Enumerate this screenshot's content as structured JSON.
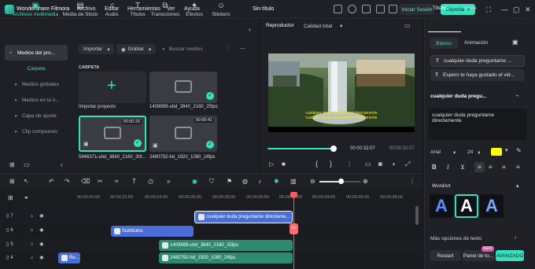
{
  "app": {
    "name": "Wondershare Filmora",
    "menu": [
      "Archivo",
      "Editar",
      "Herramientas",
      "Ver",
      "Ayuda"
    ],
    "project_title": "Sin título",
    "login_label": "Iniciar Sesión",
    "export_label": "Exportar",
    "accent": "#36e0bf"
  },
  "media_tabs": [
    {
      "label": "Archivos multimedia",
      "icon": "folder-icon"
    },
    {
      "label": "Media de Stock",
      "icon": "stock-icon"
    },
    {
      "label": "Audio",
      "icon": "music-icon"
    },
    {
      "label": "Títulos",
      "icon": "text-icon"
    },
    {
      "label": "Transiciones",
      "icon": "transition-icon"
    },
    {
      "label": "Efectos",
      "icon": "effects-icon"
    },
    {
      "label": "Stickers",
      "icon": "sticker-icon"
    }
  ],
  "sidebar": [
    {
      "label": "Medios del pro..."
    },
    {
      "label": "Carpeta"
    },
    {
      "label": "Medios globales"
    },
    {
      "label": "Medios en la n..."
    },
    {
      "label": "Capa de ajuste"
    },
    {
      "label": "Clip compuesto"
    }
  ],
  "media_toolbar": {
    "import_label": "Importar",
    "record_label": "Grabar",
    "search_placeholder": "Buscar medios"
  },
  "folder_header": "CARPETA",
  "media_items": [
    {
      "label": "Importar proyecto",
      "duration": ""
    },
    {
      "label": "1409899-uhd_3840_2160_25fps",
      "duration": ""
    },
    {
      "label": "5946371-uhd_3840_2160_30f...",
      "duration": "00:00:20"
    },
    {
      "label": "2480792-hd_1920_1080_24fps",
      "duration": "00:00:41"
    }
  ],
  "player": {
    "tab_label": "Reproductor",
    "quality_label": "Calidad total",
    "subtitle_line1": "cualquier duda preguntame directamente",
    "subtitle_line2": "cualquier duda preguntame directamente",
    "current_time": "00:00:32:07",
    "total_time": "00:00:32:07",
    "progress": 0.9
  },
  "right_panel": {
    "tabs": [
      "Títulos",
      "Video"
    ],
    "subtabs": [
      "Básico",
      "Animación"
    ],
    "text_items": [
      "cualquier duda preguntame ...",
      "Espero te haya gustado el vid..."
    ],
    "section_title": "cualquier duda pregu...",
    "text_value": "cualquier duda preguntame directamente",
    "font": "Arial",
    "font_size": "24",
    "text_color": "#ffff00",
    "wordart_label": "WordArt",
    "more_options": "Más opciones de texto",
    "reset_label": "Restart",
    "panel_label": "Panel de to...",
    "new_badge": "NEW",
    "advanced_label": "AVANZADO"
  },
  "timeline": {
    "ruler": [
      "00:00:20:00",
      "00:00:22:00",
      "00:00:24:00",
      "00:00:26:00",
      "00:00:28:00",
      "00:00:30:00",
      "00:00:32:00",
      "00:00:34:00",
      "00:00:36:00",
      "00:00:38:00"
    ],
    "clips": [
      {
        "label": "cualquier duda preguntame directame...",
        "track": 0,
        "kind": "title"
      },
      {
        "label": "Subtítulos",
        "track": 1,
        "kind": "subtitle"
      },
      {
        "label": "1409899-uhd_3840_2160_25fps",
        "track": 2,
        "kind": "video"
      },
      {
        "label": "2480792-hd_1920_1080_24fps",
        "track": 3,
        "kind": "video"
      },
      {
        "label": "Re...",
        "track": 3,
        "kind": "video-small"
      }
    ],
    "track_numbers": [
      "7",
      "6",
      "5",
      "4"
    ]
  }
}
